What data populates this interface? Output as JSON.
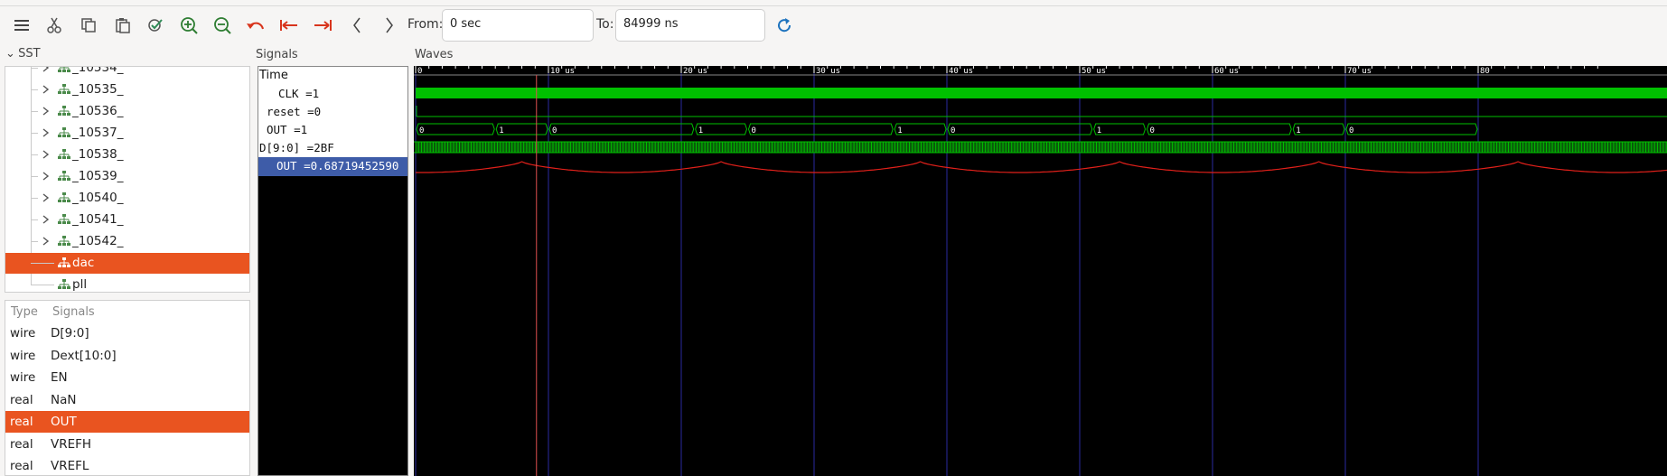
{
  "toolbar": {
    "from_label": "From:",
    "from_value": "0 sec",
    "to_label": "To:",
    "to_value": "84999 ns",
    "icons": [
      "menu-icon",
      "cut-icon",
      "copy-icon",
      "paste-icon",
      "select-all-icon",
      "zoom-in-icon",
      "zoom-out-icon",
      "undo-zoom-icon",
      "zoom-to-start-icon",
      "zoom-to-end-icon",
      "prev-edge-icon",
      "next-edge-icon",
      "reload-icon"
    ]
  },
  "sst": {
    "title": "SST",
    "tree": [
      {
        "label": "_10534_",
        "expandable": true,
        "selected": false
      },
      {
        "label": "_10535_",
        "expandable": true,
        "selected": false
      },
      {
        "label": "_10536_",
        "expandable": true,
        "selected": false
      },
      {
        "label": "_10537_",
        "expandable": true,
        "selected": false
      },
      {
        "label": "_10538_",
        "expandable": true,
        "selected": false
      },
      {
        "label": "_10539_",
        "expandable": true,
        "selected": false
      },
      {
        "label": "_10540_",
        "expandable": true,
        "selected": false
      },
      {
        "label": "_10541_",
        "expandable": true,
        "selected": false
      },
      {
        "label": "_10542_",
        "expandable": true,
        "selected": false
      },
      {
        "label": "dac",
        "expandable": false,
        "selected": true
      },
      {
        "label": "pll",
        "expandable": false,
        "selected": false
      }
    ]
  },
  "signal_list": {
    "col_type": "Type",
    "col_signals": "Signals",
    "rows": [
      {
        "type": "wire",
        "name": "D[9:0]",
        "selected": false
      },
      {
        "type": "wire",
        "name": "Dext[10:0]",
        "selected": false
      },
      {
        "type": "wire",
        "name": "EN",
        "selected": false
      },
      {
        "type": "real",
        "name": "NaN",
        "selected": false
      },
      {
        "type": "real",
        "name": "OUT",
        "selected": true
      },
      {
        "type": "real",
        "name": "VREFH",
        "selected": false
      },
      {
        "type": "real",
        "name": "VREFL",
        "selected": false
      }
    ]
  },
  "signals_pane": {
    "title": "Signals",
    "rows": [
      {
        "text": "Time",
        "selected": false
      },
      {
        "text": "CLK =1",
        "selected": false
      },
      {
        "text": "reset =0",
        "selected": false
      },
      {
        "text": "OUT =1",
        "selected": false
      },
      {
        "text": "D[9:0] =2BF",
        "selected": false
      },
      {
        "text": "OUT =0.68719452590",
        "selected": true
      }
    ]
  },
  "waves": {
    "title": "Waves",
    "time_unit": "us",
    "ticks": [
      "0",
      "10 us",
      "20 us",
      "30 us",
      "40 us",
      "50 us",
      "60 us",
      "70 us",
      "80"
    ],
    "marker_time_us": 9.1,
    "out_bit": {
      "segments": [
        {
          "start_us": 0,
          "end_us": 6.0,
          "value": "0"
        },
        {
          "start_us": 6.0,
          "end_us": 10.0,
          "value": "1"
        },
        {
          "start_us": 10.0,
          "end_us": 21.0,
          "value": "0"
        },
        {
          "start_us": 21.0,
          "end_us": 25.0,
          "value": "1"
        },
        {
          "start_us": 25.0,
          "end_us": 36.0,
          "value": "0"
        },
        {
          "start_us": 36.0,
          "end_us": 40.0,
          "value": "1"
        },
        {
          "start_us": 40.0,
          "end_us": 51.0,
          "value": "0"
        },
        {
          "start_us": 51.0,
          "end_us": 55.0,
          "value": "1"
        },
        {
          "start_us": 55.0,
          "end_us": 66.0,
          "value": "0"
        },
        {
          "start_us": 66.0,
          "end_us": 70.0,
          "value": "1"
        },
        {
          "start_us": 70.0,
          "end_us": 80.0,
          "value": "0"
        }
      ]
    },
    "analog_peaks_us": [
      8.0,
      23.0,
      38.0,
      53.0,
      68.0
    ],
    "colors": {
      "digital": "#00c000",
      "analog": "#e0201a",
      "marker": "#e05050",
      "grid": "#2a2aa0",
      "tick_text": "#ffffff"
    }
  }
}
